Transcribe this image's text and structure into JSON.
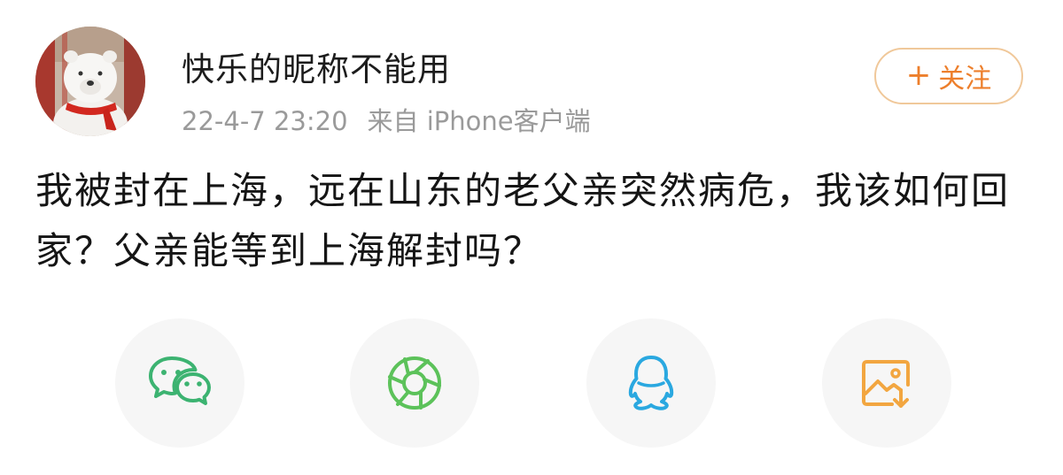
{
  "post": {
    "author": {
      "username": "快乐的昵称不能用",
      "avatar_icon": "polar-bear-avatar"
    },
    "meta": {
      "timestamp": "22-4-7 23:20",
      "source": "来自 iPhone客户端"
    },
    "follow_button": {
      "plus": "+",
      "label": "关注"
    },
    "content": "我被封在上海，远在山东的老父亲突然病危，我该如何回家？父亲能等到上海解封吗？"
  },
  "share": {
    "items": [
      {
        "icon": "wechat-icon",
        "color": "#3cb371"
      },
      {
        "icon": "moments-icon",
        "color": "#5cc25a"
      },
      {
        "icon": "qq-icon",
        "color": "#2aa8e0"
      },
      {
        "icon": "save-image-icon",
        "color": "#f2a640"
      }
    ]
  },
  "colors": {
    "follow_accent": "#ed7f2c",
    "follow_border": "#f0c89a",
    "meta_text": "#9a9a9a",
    "share_bg": "#f6f6f6"
  }
}
